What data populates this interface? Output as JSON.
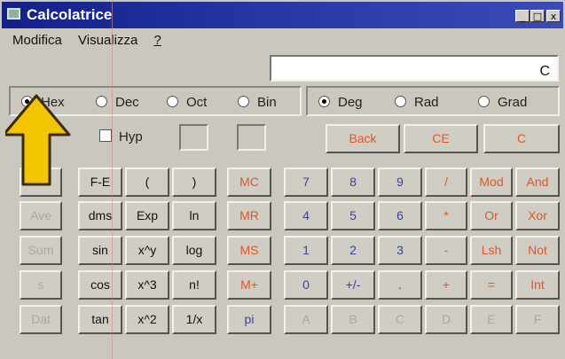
{
  "window": {
    "title": "Calcolatrice",
    "min": "_",
    "max": "□",
    "close": "x"
  },
  "menu": {
    "items": [
      "Modifica",
      "Visualizza",
      "?"
    ]
  },
  "display": {
    "value": "C"
  },
  "base_radios": [
    "Hex",
    "Dec",
    "Oct",
    "Bin"
  ],
  "angle_radios": [
    "Deg",
    "Rad",
    "Grad"
  ],
  "hyp_label": "Hyp",
  "buttons": {
    "back": "Back",
    "ce": "CE",
    "c": "C",
    "stat": [
      "",
      "Ave",
      "Sum",
      "s",
      "Dat"
    ],
    "sci": [
      [
        "F-E",
        "(",
        ")"
      ],
      [
        "dms",
        "Exp",
        "ln"
      ],
      [
        "sin",
        "x^y",
        "log"
      ],
      [
        "cos",
        "x^3",
        "n!"
      ],
      [
        "tan",
        "x^2",
        "1/x"
      ]
    ],
    "mem": [
      "MC",
      "MR",
      "MS",
      "M+",
      "pi"
    ],
    "pad": [
      [
        "7",
        "8",
        "9",
        "/",
        "Mod",
        "And"
      ],
      [
        "4",
        "5",
        "6",
        "*",
        "Or",
        "Xor"
      ],
      [
        "1",
        "2",
        "3",
        "-",
        "Lsh",
        "Not"
      ],
      [
        "0",
        "+/-",
        ".",
        "+",
        "=",
        "Int"
      ],
      [
        "A",
        "B",
        "C",
        "D",
        "E",
        "F"
      ]
    ]
  },
  "colors": {
    "title": "#13208a",
    "red_text": "#e0562a",
    "blue_text": "#3a43a0",
    "arrow": "#f2c500"
  }
}
